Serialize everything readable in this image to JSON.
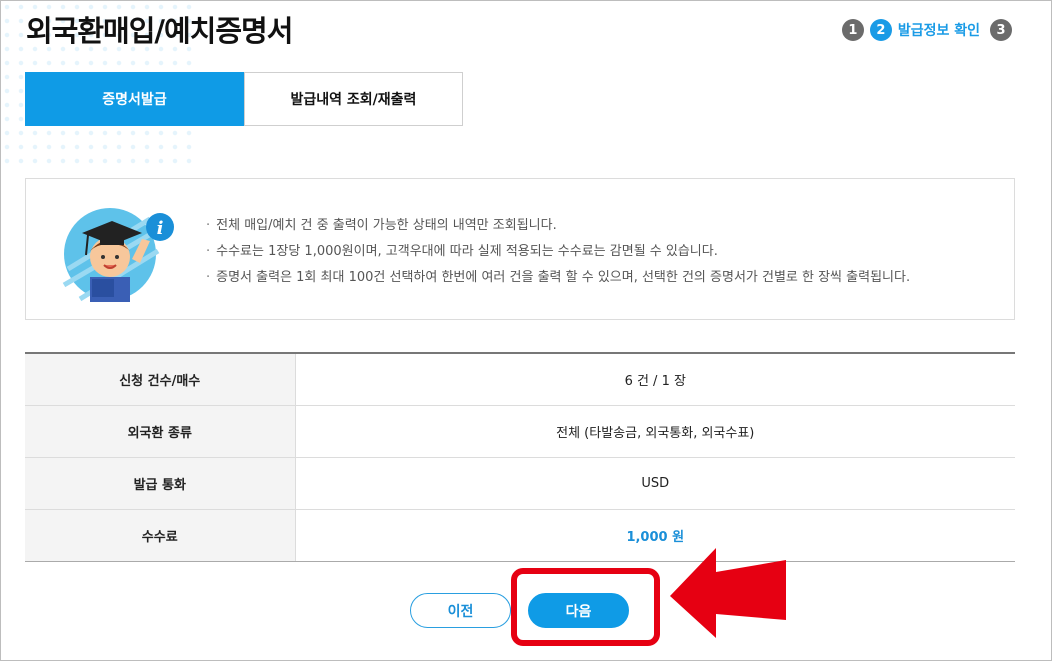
{
  "page": {
    "title": "외국환매입/예치증명서"
  },
  "steps": [
    {
      "number": "1",
      "label": ""
    },
    {
      "number": "2",
      "label": "발급정보 확인"
    },
    {
      "number": "3",
      "label": ""
    }
  ],
  "tabs": [
    {
      "label": "증명서발급"
    },
    {
      "label": "발급내역 조회/재출력"
    }
  ],
  "notice": {
    "items": [
      "전체 매입/예치 건 중 출력이 가능한 상태의 내역만 조회됩니다.",
      "수수료는 1장당 1,000원이며, 고객우대에 따라 실제 적용되는 수수료는 감면될 수 있습니다.",
      "증명서 출력은 1회 최대 100건 선택하여 한번에 여러 건을 출력 할 수 있으며, 선택한 건의 증명서가 건별로 한 장씩 출력됩니다."
    ]
  },
  "info_table": {
    "rows": [
      {
        "label": "신청 건수/매수",
        "value": "6 건 / 1 장"
      },
      {
        "label": "외국환 종류",
        "value": "전체 (타발송금, 외국통화, 외국수표)"
      },
      {
        "label": "발급 통화",
        "value": "USD"
      },
      {
        "label": "수수료",
        "value": "1,000 원"
      }
    ]
  },
  "buttons": {
    "prev": "이전",
    "next": "다음"
  },
  "colors": {
    "accent": "#0f9be6",
    "highlight": "#e60012"
  }
}
